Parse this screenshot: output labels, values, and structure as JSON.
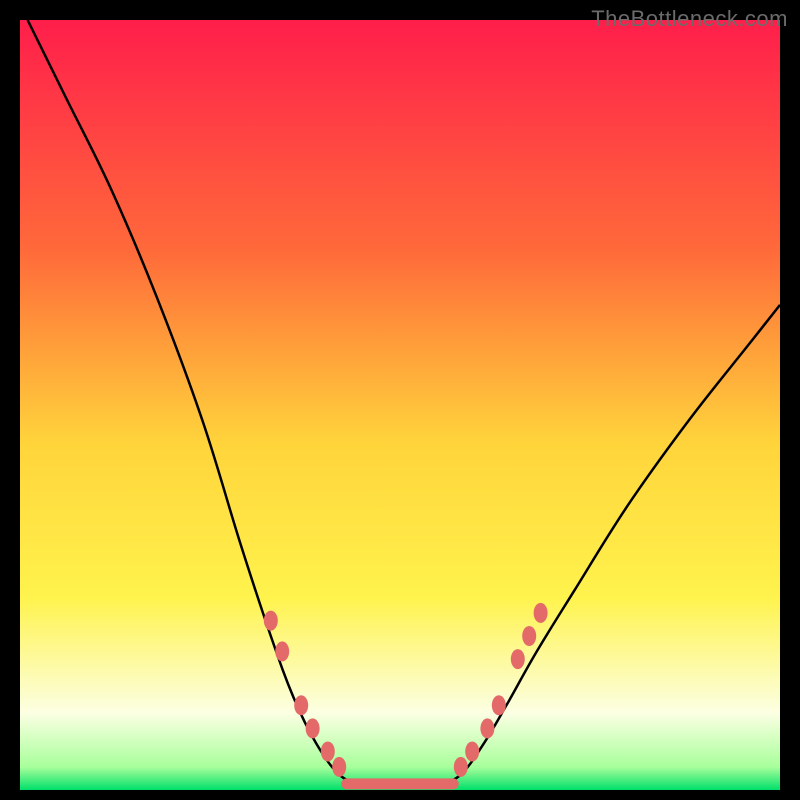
{
  "watermark": "TheBottleneck.com",
  "chart_data": {
    "type": "line",
    "title": "",
    "xlabel": "",
    "ylabel": "",
    "xlim": [
      0,
      100
    ],
    "ylim": [
      0,
      100
    ],
    "background_gradient": {
      "stops": [
        {
          "offset": 0,
          "color": "#ff1e4b"
        },
        {
          "offset": 30,
          "color": "#ff6a3a"
        },
        {
          "offset": 55,
          "color": "#ffd43b"
        },
        {
          "offset": 75,
          "color": "#fff34d"
        },
        {
          "offset": 90,
          "color": "#fcffe3"
        },
        {
          "offset": 97,
          "color": "#a8ff9b"
        },
        {
          "offset": 100,
          "color": "#00e06a"
        }
      ]
    },
    "series": [
      {
        "name": "left-curve",
        "color": "#000000",
        "points": [
          {
            "x": 1,
            "y": 100
          },
          {
            "x": 6,
            "y": 90
          },
          {
            "x": 12,
            "y": 78
          },
          {
            "x": 18,
            "y": 64
          },
          {
            "x": 24,
            "y": 48
          },
          {
            "x": 29,
            "y": 32
          },
          {
            "x": 33,
            "y": 20
          },
          {
            "x": 36,
            "y": 12
          },
          {
            "x": 39,
            "y": 6
          },
          {
            "x": 42,
            "y": 2
          },
          {
            "x": 45,
            "y": 0.5
          }
        ]
      },
      {
        "name": "right-curve",
        "color": "#000000",
        "points": [
          {
            "x": 55,
            "y": 0.5
          },
          {
            "x": 58,
            "y": 2
          },
          {
            "x": 61,
            "y": 6
          },
          {
            "x": 64,
            "y": 11
          },
          {
            "x": 68,
            "y": 18
          },
          {
            "x": 73,
            "y": 26
          },
          {
            "x": 80,
            "y": 37
          },
          {
            "x": 88,
            "y": 48
          },
          {
            "x": 96,
            "y": 58
          },
          {
            "x": 100,
            "y": 63
          }
        ]
      }
    ],
    "markers_left": [
      {
        "x": 33.0,
        "y": 22
      },
      {
        "x": 34.5,
        "y": 18
      },
      {
        "x": 37.0,
        "y": 11
      },
      {
        "x": 38.5,
        "y": 8
      },
      {
        "x": 40.5,
        "y": 5
      },
      {
        "x": 42.0,
        "y": 3
      }
    ],
    "markers_right": [
      {
        "x": 58.0,
        "y": 3
      },
      {
        "x": 59.5,
        "y": 5
      },
      {
        "x": 61.5,
        "y": 8
      },
      {
        "x": 63.0,
        "y": 11
      },
      {
        "x": 65.5,
        "y": 17
      },
      {
        "x": 67.0,
        "y": 20
      },
      {
        "x": 68.5,
        "y": 23
      }
    ],
    "flat_segment": {
      "x1": 43,
      "x2": 57,
      "y": 0.8,
      "color": "#e46a6a",
      "width": 11
    },
    "marker_style": {
      "fill": "#e46a6a",
      "rx": 7,
      "ry": 10
    }
  }
}
